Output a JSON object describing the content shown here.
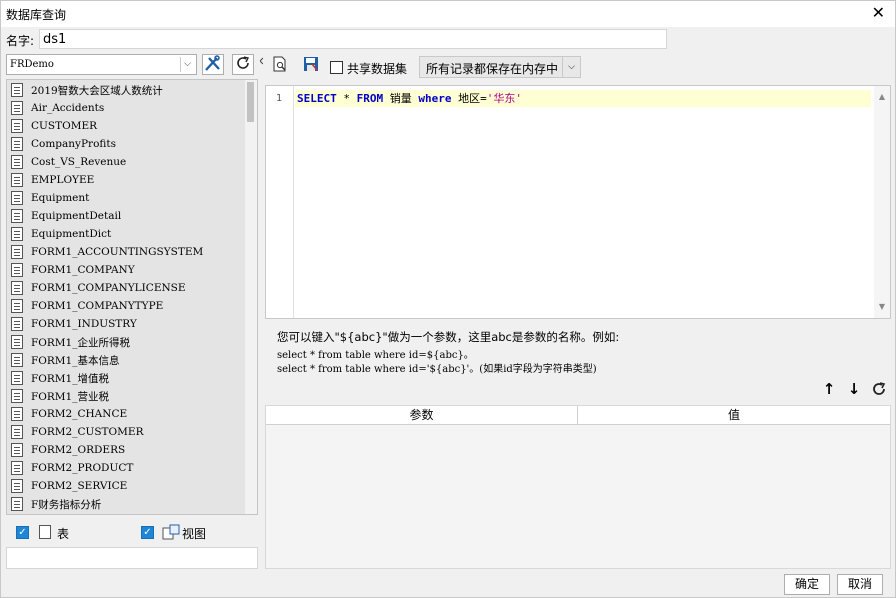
{
  "window": {
    "title": "数据库查询",
    "close_glyph": "✕"
  },
  "name_field": {
    "label": "名字:",
    "value": "ds1"
  },
  "left": {
    "db_select": {
      "value": "FRDemo",
      "arrow": "⌵"
    },
    "tables": [
      "2019智数大会区域人数统计",
      "Air_Accidents",
      "CUSTOMER",
      "CompanyProfits",
      "Cost_VS_Revenue",
      "EMPLOYEE",
      "Equipment",
      "EquipmentDetail",
      "EquipmentDict",
      "FORM1_ACCOUNTINGSYSTEM",
      "FORM1_COMPANY",
      "FORM1_COMPANYLICENSE",
      "FORM1_COMPANYTYPE",
      "FORM1_INDUSTRY",
      "FORM1_企业所得税",
      "FORM1_基本信息",
      "FORM1_增值税",
      "FORM1_营业税",
      "FORM2_CHANCE",
      "FORM2_CUSTOMER",
      "FORM2_ORDERS",
      "FORM2_PRODUCT",
      "FORM2_SERVICE",
      "F财务指标分析"
    ],
    "filter_table_label": "表",
    "filter_view_label": "视图"
  },
  "right": {
    "share_label": "共享数据集",
    "memory_select": "所有记录都保存在内存中",
    "editor": {
      "line_no": "1",
      "sql_kw1": "SELECT",
      "sql_star": " * ",
      "sql_kw2": "FROM",
      "sql_table": " 销量 ",
      "sql_kw3": "where",
      "sql_field": " 地区=",
      "sql_str": "'华东'"
    },
    "hint_line1": "您可以键入\"${abc}\"做为一个参数，这里abc是参数的名称。例如:",
    "hint_line2": "select * from table where id=${abc}。",
    "hint_line3": "select * from table where id='${abc}'。(如果id字段为字符串类型)",
    "params_header_param": "参数",
    "params_header_value": "值"
  },
  "footer": {
    "ok": "确定",
    "cancel": "取消"
  }
}
